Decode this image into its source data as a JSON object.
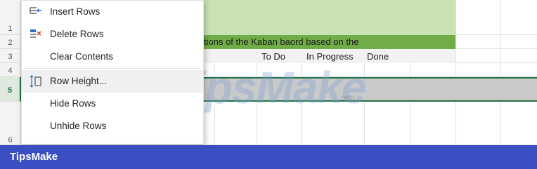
{
  "context_menu": {
    "items": [
      {
        "label": "Insert Rows",
        "icon": "insert-rows-icon"
      },
      {
        "label": "Delete Rows",
        "icon": "delete-rows-icon"
      },
      {
        "label": "Clear Contents",
        "icon": ""
      },
      {
        "label": "Row Height...",
        "icon": "row-height-icon"
      },
      {
        "label": "Hide Rows",
        "icon": ""
      },
      {
        "label": "Unhide Rows",
        "icon": ""
      }
    ]
  },
  "grid": {
    "row_numbers": [
      "1",
      "2",
      "3",
      "4",
      "5",
      "6"
    ],
    "selected_row": "5",
    "row2_text": "tions of the Kaban baord based on the",
    "headers": [
      "To Do",
      "In Progress",
      "Done"
    ]
  },
  "colors": {
    "title_band": "#c9e2b3",
    "subtitle_band": "#70ad47",
    "header_band": "#f2f2f2",
    "selected_row": "#c9c9c9",
    "selection_border": "#217346",
    "footer": "#3b4fc4"
  },
  "watermark": {
    "text": "TipsMake",
    "subtext": ".com"
  },
  "footer": {
    "brand": "TipsMake"
  }
}
